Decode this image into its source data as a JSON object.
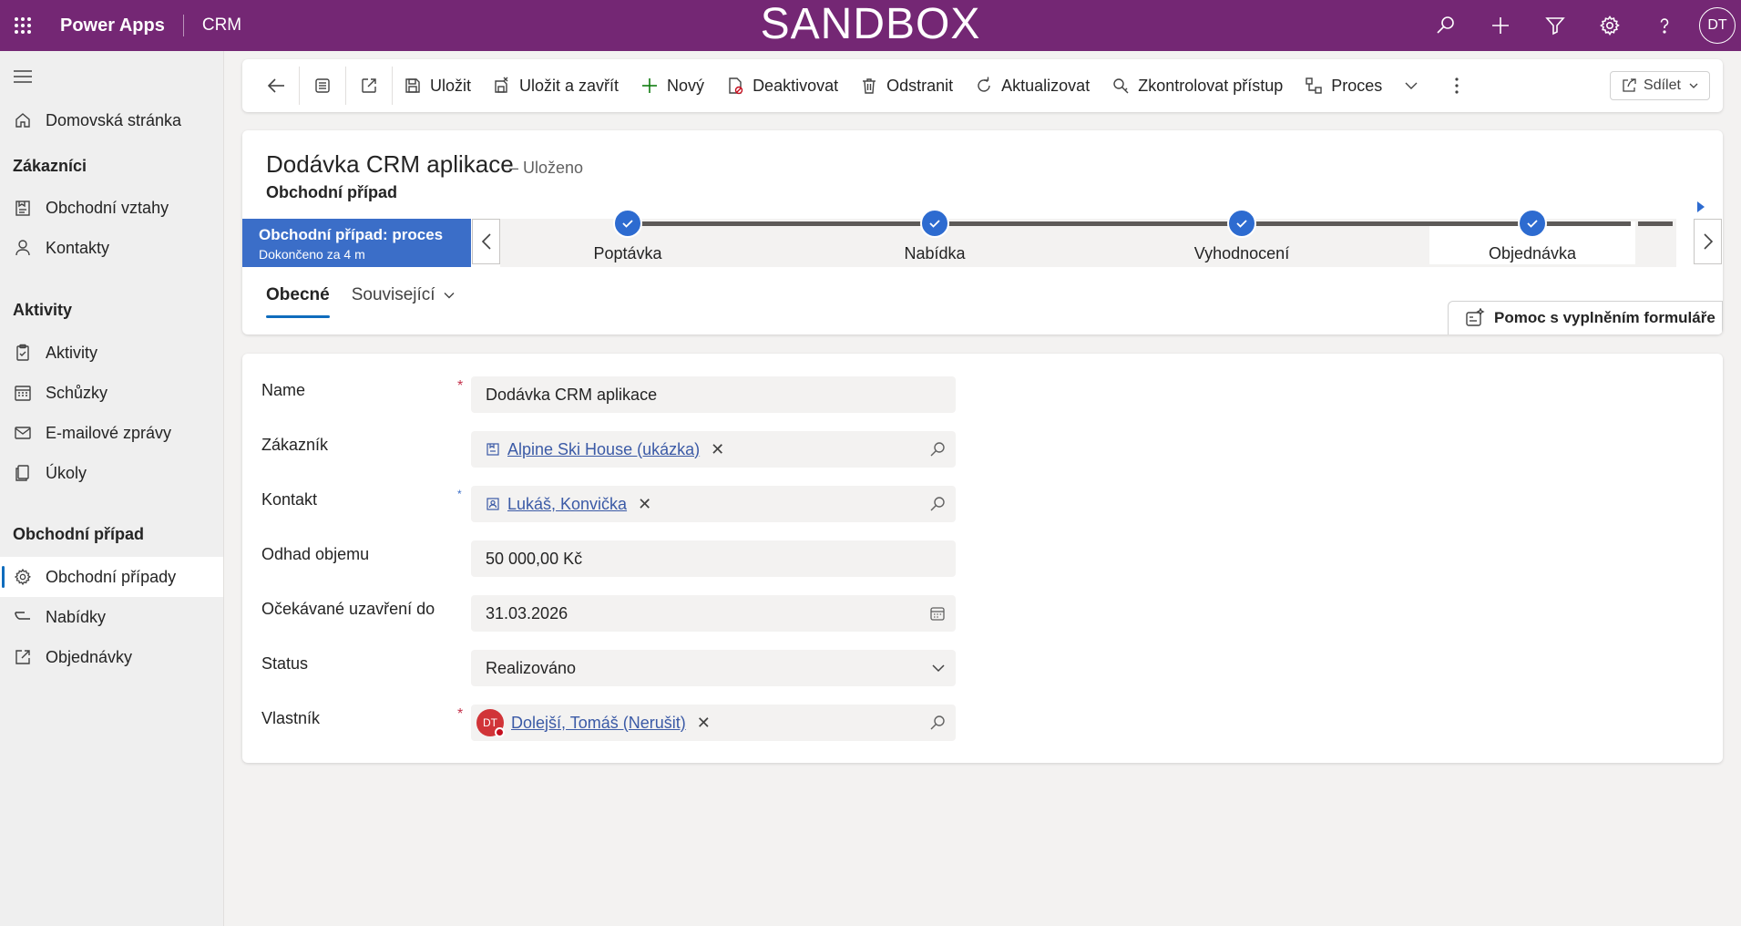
{
  "topbar": {
    "app_name": "Power Apps",
    "environment": "CRM",
    "banner": "SANDBOX",
    "user_initials": "DT"
  },
  "sidebar": {
    "items": [
      {
        "label": "Domovská stránka",
        "icon": "home-icon"
      },
      {
        "label": "Obchodní vztahy",
        "icon": "account-icon"
      },
      {
        "label": "Kontakty",
        "icon": "person-icon"
      },
      {
        "label": "Aktivity",
        "icon": "clipboard-icon"
      },
      {
        "label": "Schůzky",
        "icon": "calendar-icon"
      },
      {
        "label": "E-mailové zprávy",
        "icon": "mail-icon"
      },
      {
        "label": "Úkoly",
        "icon": "task-icon"
      },
      {
        "label": "Obchodní případy",
        "icon": "gear-icon"
      },
      {
        "label": "Nabídky",
        "icon": "quote-icon"
      },
      {
        "label": "Objednávky",
        "icon": "order-icon"
      }
    ],
    "groups": {
      "customers": "Zákazníci",
      "activities": "Aktivity",
      "opportunity": "Obchodní případ"
    }
  },
  "commandbar": {
    "save": "Uložit",
    "save_close": "Uložit a zavřít",
    "new": "Nový",
    "deactivate": "Deaktivovat",
    "delete": "Odstranit",
    "refresh": "Aktualizovat",
    "check_access": "Zkontrolovat přístup",
    "process": "Proces",
    "share": "Sdílet"
  },
  "record": {
    "title": "Dodávka CRM aplikace",
    "save_status": "– Uloženo",
    "entity": "Obchodní případ"
  },
  "bpf": {
    "flyout_title": "Obchodní případ: proces",
    "flyout_subtitle": "Dokončeno za 4 m",
    "stages": [
      "Poptávka",
      "Nabídka",
      "Vyhodnocení",
      "Objednávka"
    ],
    "active_stage": "Objednávka",
    "accent_color": "#2d6bd0"
  },
  "tabs": {
    "general": "Obecné",
    "related": "Související"
  },
  "help_button": "Pomoc s vyplněním formuláře",
  "form": {
    "name": {
      "label": "Name",
      "value": "Dodávka CRM aplikace",
      "required": "*"
    },
    "customer": {
      "label": "Zákazník",
      "value": "Alpine Ski House (ukázka)"
    },
    "contact": {
      "label": "Kontakt",
      "value": "Lukáš, Konvička",
      "required": "*"
    },
    "est_value": {
      "label": "Odhad objemu",
      "value": "50 000,00 Kč"
    },
    "close_date": {
      "label": "Očekávané uzavření do",
      "value": "31.03.2026"
    },
    "status": {
      "label": "Status",
      "value": "Realizováno"
    },
    "owner": {
      "label": "Vlastník",
      "value": "Dolejší, Tomáš (Nerušit)",
      "initials": "DT",
      "required": "*"
    },
    "remove_glyph": "✕"
  },
  "colors": {
    "brand": "#742774",
    "accent": "#0f6cbd"
  }
}
